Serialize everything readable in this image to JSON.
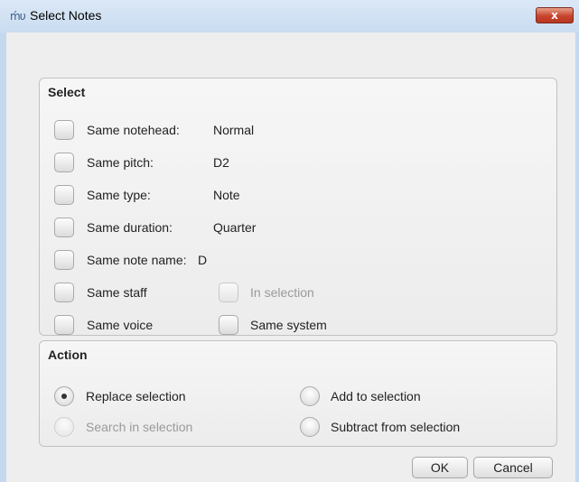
{
  "window": {
    "title": "Select Notes",
    "close_glyph": "x",
    "app_icon": "musescore-icon"
  },
  "select": {
    "title": "Select",
    "rows": [
      {
        "label": "Same notehead:",
        "value": "Normal",
        "checked": false
      },
      {
        "label": "Same pitch:",
        "value": "D2",
        "checked": false
      },
      {
        "label": "Same type:",
        "value": "Note",
        "checked": false
      },
      {
        "label": "Same duration:",
        "value": "Quarter",
        "checked": false
      },
      {
        "label": "Same note name:",
        "value": "D",
        "checked": false
      }
    ],
    "same_staff": "Same staff",
    "in_selection": "In selection",
    "same_voice": "Same voice",
    "same_system": "Same system"
  },
  "action": {
    "title": "Action",
    "replace": "Replace selection",
    "add": "Add to selection",
    "search": "Search in selection",
    "subtract": "Subtract from selection",
    "selected": "replace"
  },
  "buttons": {
    "ok": "OK",
    "cancel": "Cancel"
  }
}
